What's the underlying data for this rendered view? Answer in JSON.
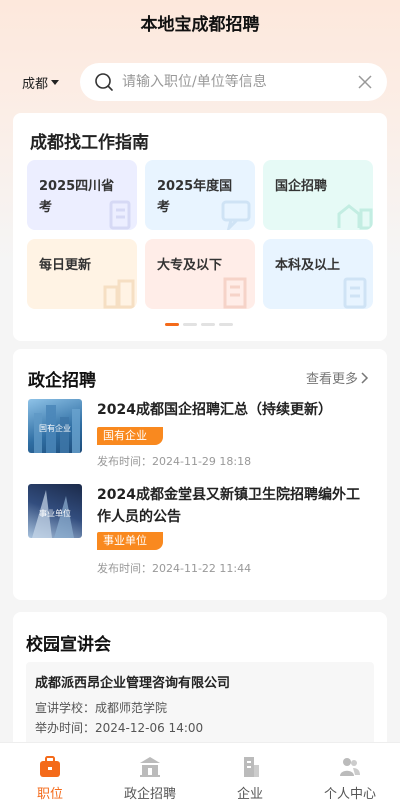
{
  "header": {
    "title": "本地宝成都招聘"
  },
  "search": {
    "city": "成都",
    "placeholder": "请输入职位/单位等信息"
  },
  "guide": {
    "title": "成都找工作指南",
    "tiles": [
      {
        "label": "2025四川省考",
        "bg": "#eceeff"
      },
      {
        "label": "2025年度国考",
        "bg": "#e8f4ff"
      },
      {
        "label": "国企招聘",
        "bg": "#e6faf6"
      },
      {
        "label": "每日更新",
        "bg": "#fff3e4"
      },
      {
        "label": "大专及以下",
        "bg": "#ffede8"
      },
      {
        "label": "本科及以上",
        "bg": "#e8f4ff"
      }
    ]
  },
  "gov": {
    "title": "政企招聘",
    "more": "查看更多",
    "items": [
      {
        "thumb": "国有企业",
        "title": "2024成都国企招聘汇总（持续更新）",
        "tag": "国有企业",
        "time": "发布时间：2024-11-29 18:18"
      },
      {
        "thumb": "事业单位",
        "title": "2024成都金堂县又新镇卫生院招聘编外工作人员的公告",
        "tag": "事业单位",
        "time": "发布时间：2024-11-22 11:44"
      }
    ]
  },
  "campus": {
    "title": "校园宣讲会",
    "items": [
      {
        "company": "成都派西昂企业管理咨询有限公司",
        "school": "宣讲学校：成都师范学院",
        "time": "举办时间：2024-12-06 14:00"
      }
    ]
  },
  "tabs": [
    {
      "label": "职位",
      "icon": "briefcase-icon"
    },
    {
      "label": "政企招聘",
      "icon": "government-building-icon"
    },
    {
      "label": "企业",
      "icon": "office-building-icon"
    },
    {
      "label": "个人中心",
      "icon": "user-group-icon"
    }
  ],
  "colors": {
    "accent": "#f46a1a",
    "tag": "#f9891f"
  }
}
